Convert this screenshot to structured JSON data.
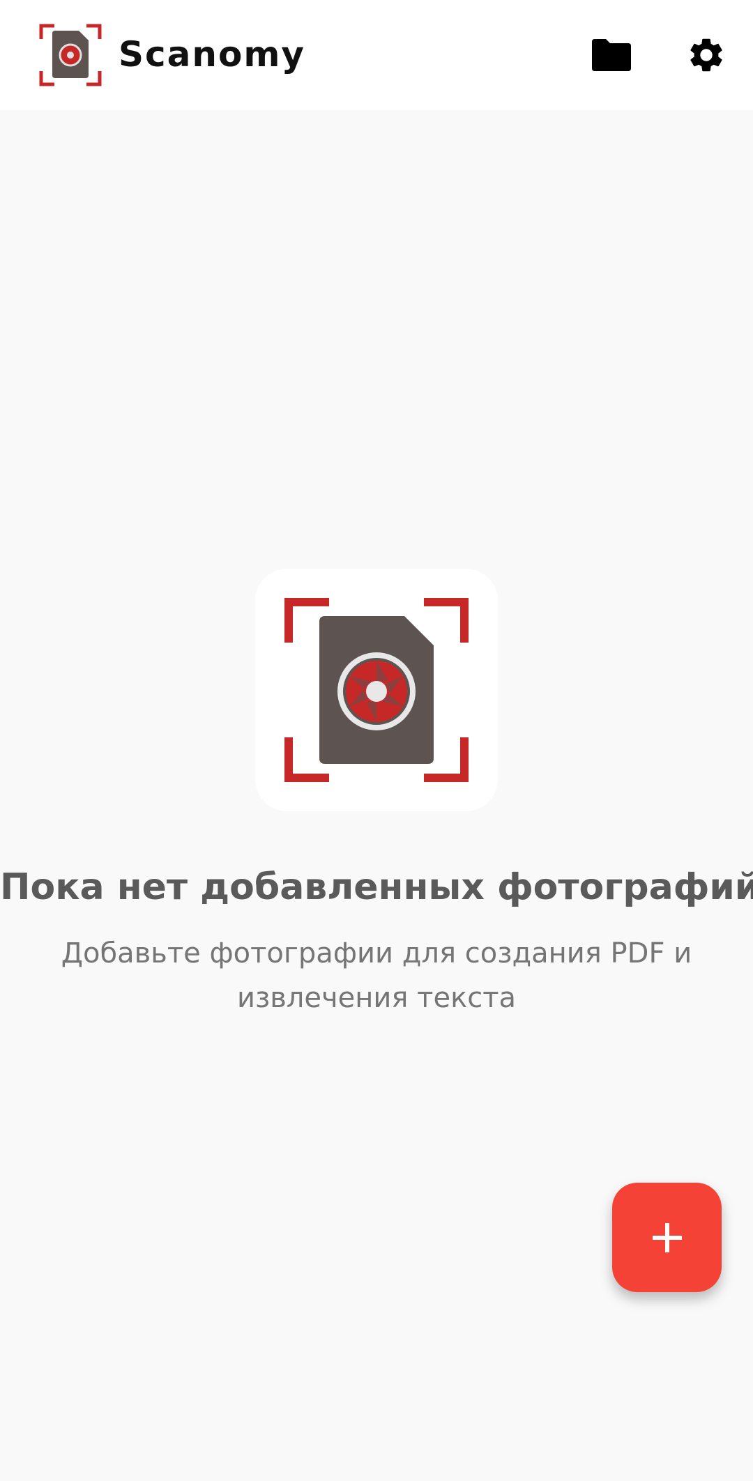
{
  "app_bar": {
    "title": "Scanomy",
    "logo_icon": "scanner-logo-icon",
    "actions": [
      {
        "icon": "folder-icon"
      },
      {
        "icon": "gear-icon"
      }
    ]
  },
  "empty_state": {
    "illustration_icon": "document-camera-icon",
    "title": "Пока нет добавленных фотографий",
    "subtitle": "Добавьте фотографии для создания PDF и извлечения текста"
  },
  "fab": {
    "icon": "plus-icon"
  },
  "colors": {
    "accent": "#f44336",
    "bracket_red": "#c62828",
    "document_gray": "#5d5350",
    "background": "#f9f9f9",
    "app_bar": "#ffffff"
  }
}
